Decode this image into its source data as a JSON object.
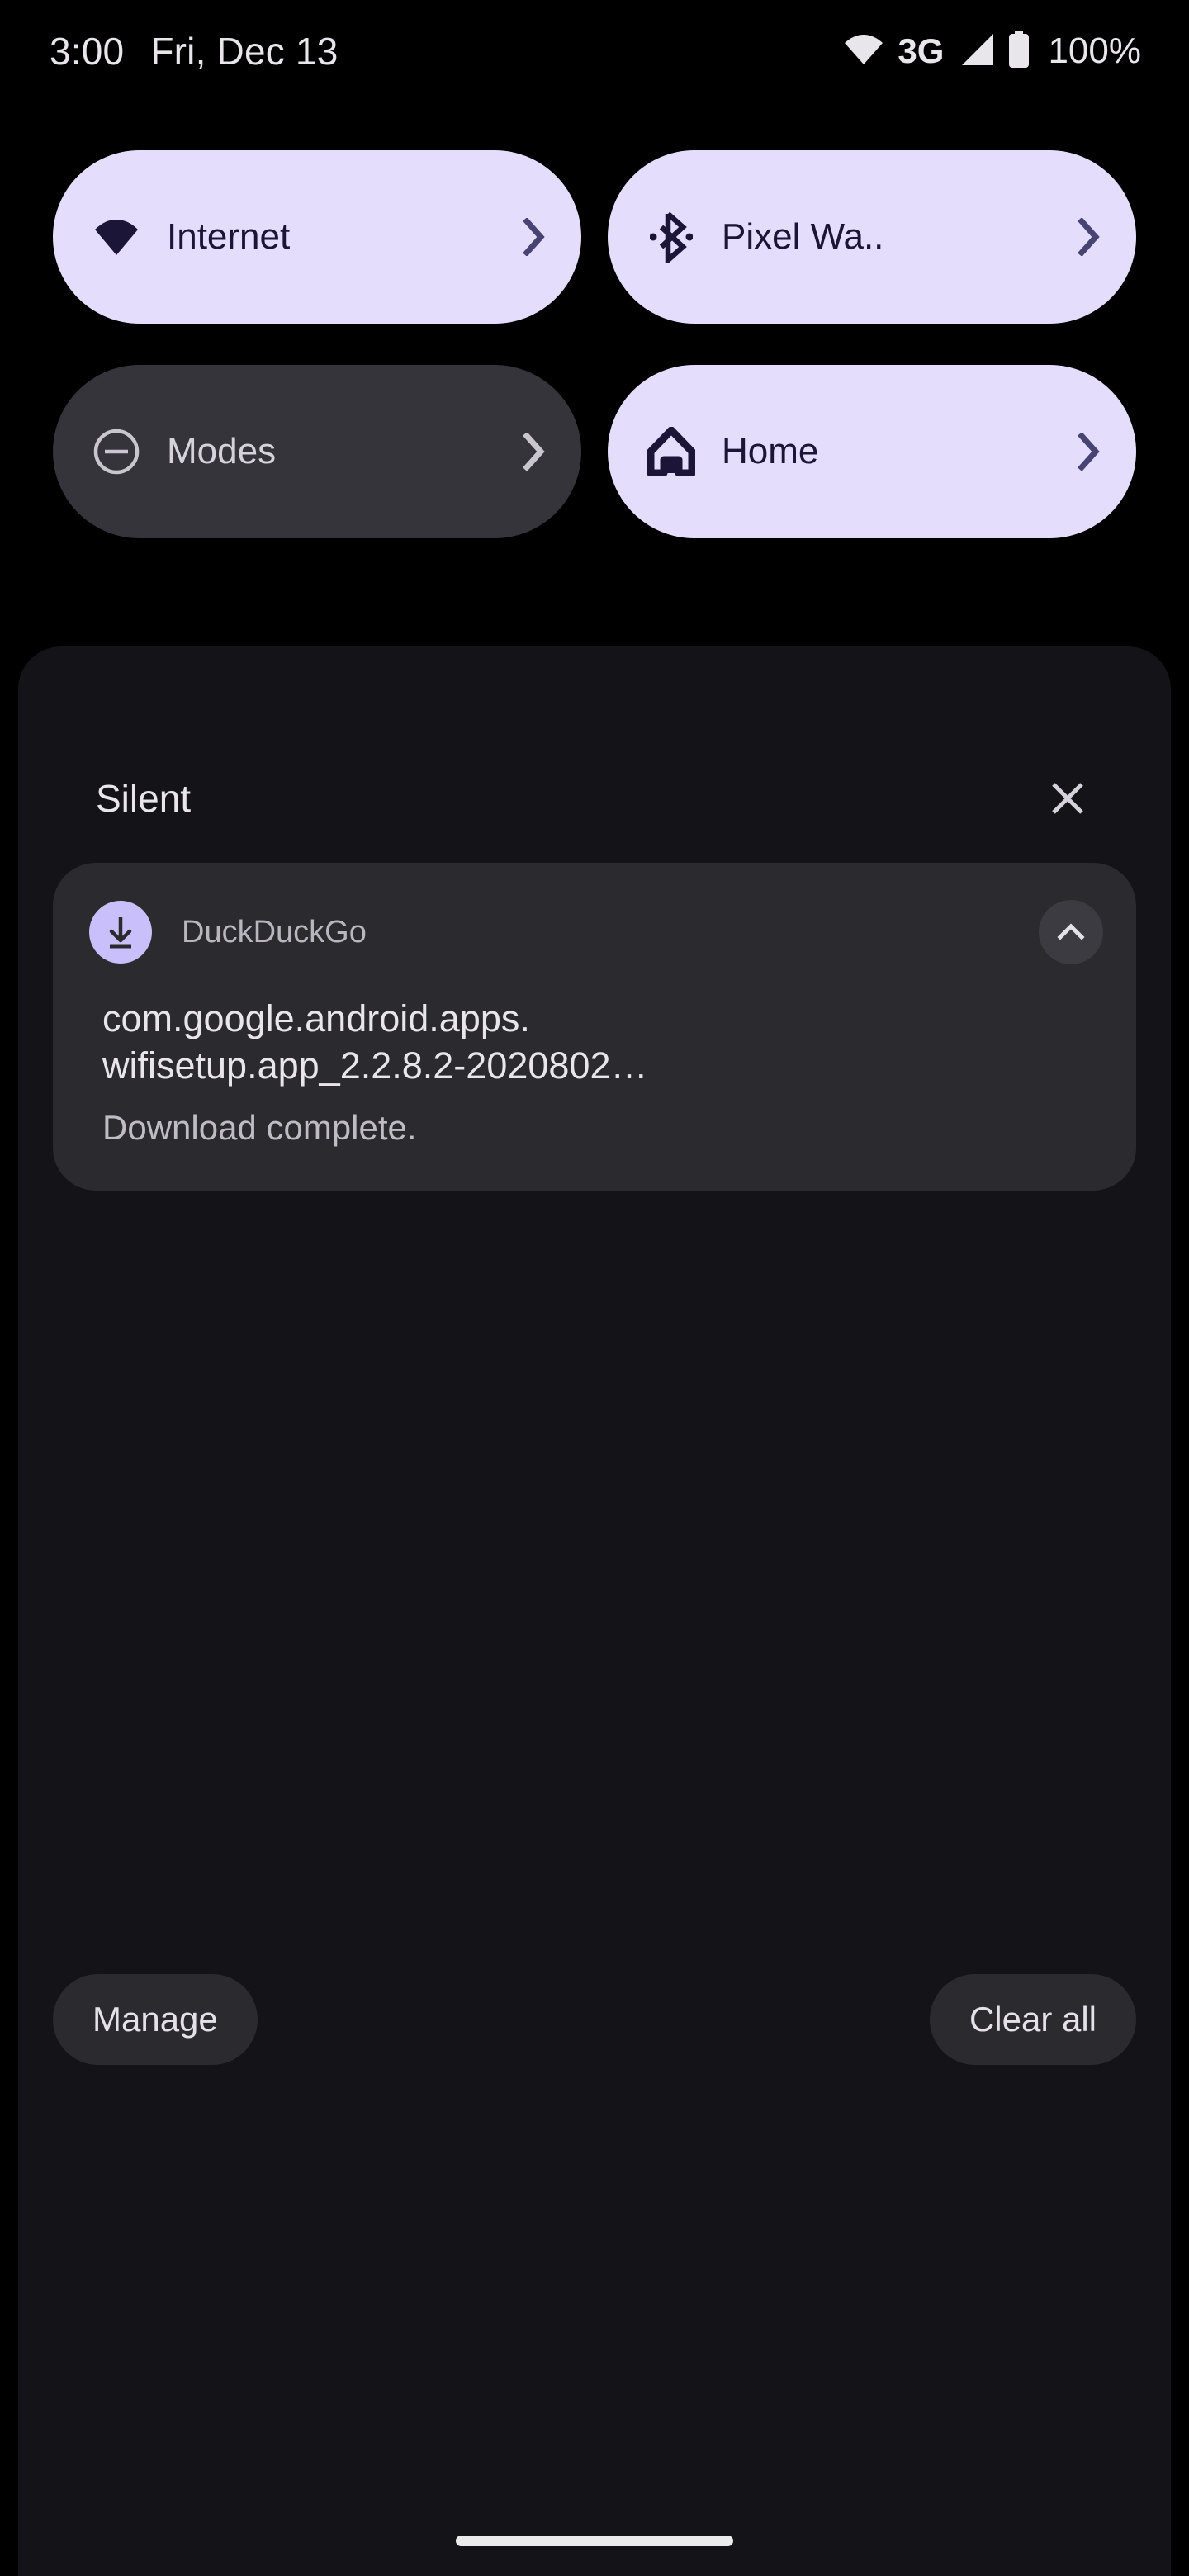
{
  "colors": {
    "screen_bg": "#000000",
    "shade_bg": "#141418",
    "tile_active_bg": "#E4DEFC",
    "tile_inactive_bg": "#35343A",
    "tile_active_fg": "#1B1537",
    "tile_inactive_fg": "#D5D2DC",
    "card_bg": "#2A2A2F",
    "app_icon_bg": "#C9C0FB",
    "text_primary": "#E8E6EB",
    "text_secondary": "#BFBCC5",
    "home_indicator": "#EBEBEB"
  },
  "status_bar": {
    "clock": "3:00",
    "date": "Fri, Dec 13",
    "wifi_icon": "wifi-icon",
    "network_type": "3G",
    "signal_icon": "cell-signal-icon",
    "battery_icon": "battery-full-icon",
    "battery_level": "100%"
  },
  "quick_settings": {
    "tiles": [
      {
        "label": "Internet",
        "icon": "wifi-icon",
        "state": "active",
        "chevron": "chevron-right-icon"
      },
      {
        "label": "Pixel Wa..",
        "icon": "bluetooth-icon",
        "state": "active",
        "chevron": "chevron-right-icon"
      },
      {
        "label": "Modes",
        "icon": "do-not-disturb-icon",
        "state": "inactive",
        "chevron": "chevron-right-icon"
      },
      {
        "label": "Home",
        "icon": "home-icon",
        "state": "active",
        "chevron": "chevron-right-icon"
      }
    ]
  },
  "shade": {
    "section_title": "Silent",
    "close_icon": "close-icon",
    "notification": {
      "app_icon": "download-icon",
      "app_name": "DuckDuckGo",
      "expand_icon": "chevron-up-icon",
      "title_line_1": "com.google.android.apps.",
      "title_line_2": "wifisetup.app_2.2.8.2-2020802…",
      "body": "Download complete."
    },
    "footer": {
      "manage_label": "Manage",
      "clear_all_label": "Clear all"
    }
  },
  "navigation": {
    "home_indicator": "home-indicator"
  }
}
